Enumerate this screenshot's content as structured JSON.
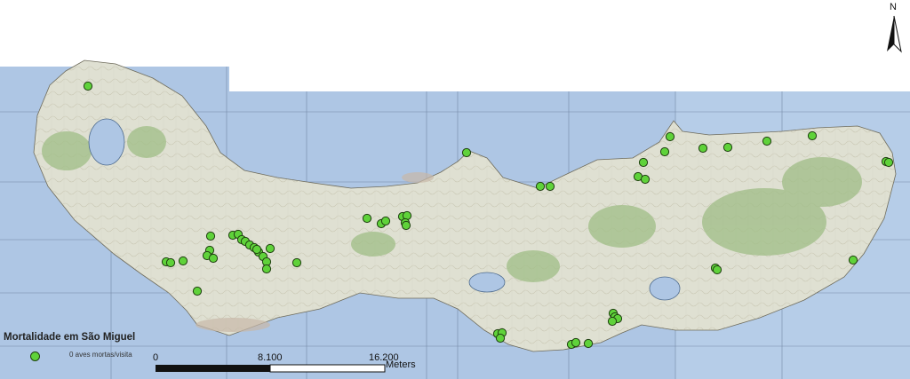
{
  "map": {
    "island": "São Miguel",
    "colors": {
      "sea": "#aec6e4",
      "land": "#dfe0d2",
      "vegetation": "#9fbd86",
      "grid": "#5a6f8c",
      "marker_fill": "#5fd23a",
      "marker_stroke": "#1f3f10"
    }
  },
  "legend": {
    "title": "Mortalidade em São Miguel",
    "item_label": "0 aves mortas/visita",
    "marker_icon": "green-circle-icon"
  },
  "scale_bar": {
    "labels": [
      "0",
      "8.100",
      "16.200"
    ],
    "unit": "Meters"
  },
  "north_arrow": {
    "label": "N",
    "icon": "north-arrow-icon"
  }
}
